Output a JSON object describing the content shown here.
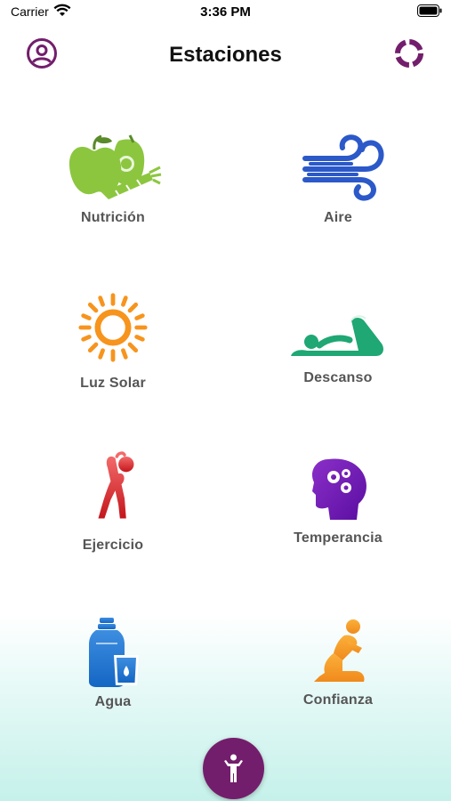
{
  "status_bar": {
    "carrier": "Carrier",
    "time": "3:36 PM"
  },
  "header": {
    "title": "Estaciones",
    "left_icon": "profile-icon",
    "right_icon": "progress-ring-icon"
  },
  "colors": {
    "brand": "#731e6c",
    "label": "#555555"
  },
  "stations": [
    {
      "label": "Nutrición",
      "icon": "fruits-vegetables-icon"
    },
    {
      "label": "Aire",
      "icon": "wind-icon"
    },
    {
      "label": "Luz Solar",
      "icon": "sun-icon"
    },
    {
      "label": "Descanso",
      "icon": "resting-person-icon"
    },
    {
      "label": "Ejercicio",
      "icon": "stretching-person-icon"
    },
    {
      "label": "Temperancia",
      "icon": "head-gears-icon"
    },
    {
      "label": "Agua",
      "icon": "water-bottle-icon"
    },
    {
      "label": "Confianza",
      "icon": "praying-person-icon"
    }
  ],
  "fab": {
    "icon": "person-icon"
  }
}
